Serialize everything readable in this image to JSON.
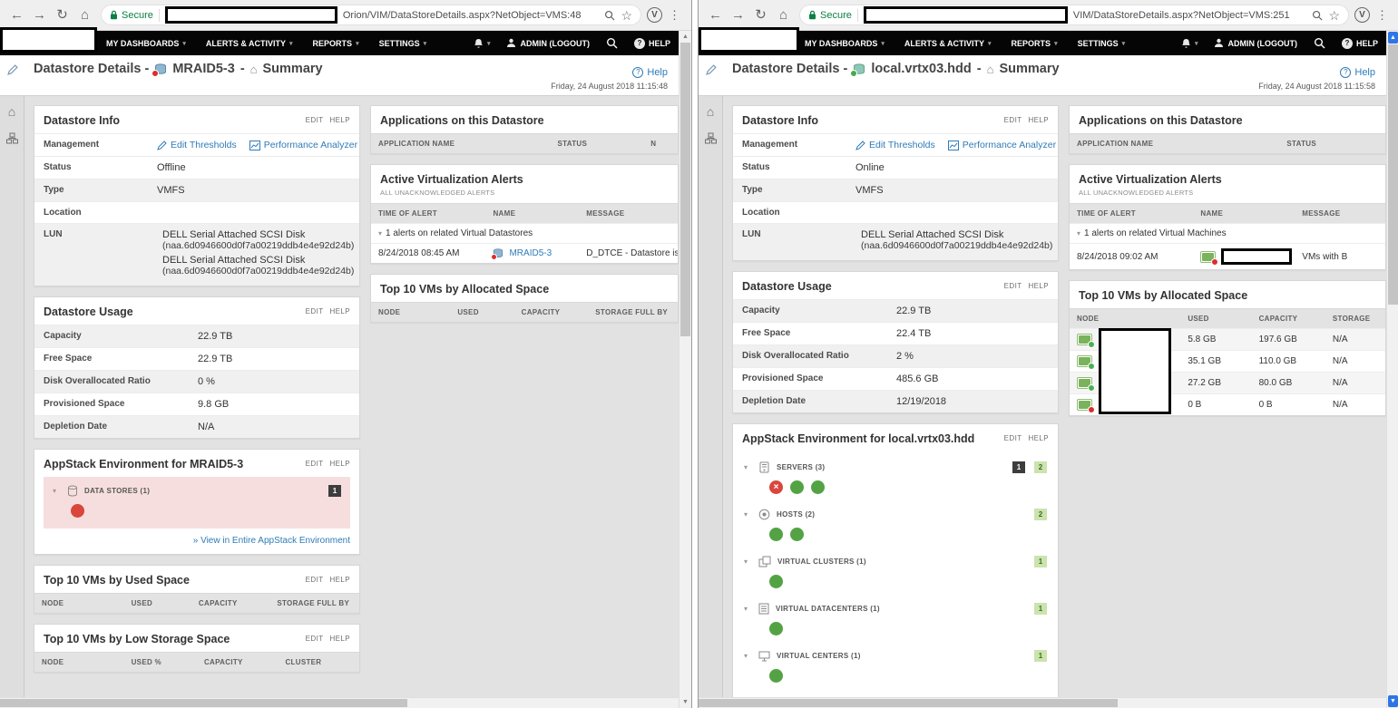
{
  "windows": {
    "left": {
      "browser": {
        "secure": "Secure",
        "url": "Orion/VIM/DataStoreDetails.aspx?NetObject=VMS:48"
      },
      "nav": {
        "dashboards": "MY DASHBOARDS",
        "alerts": "ALERTS & ACTIVITY",
        "reports": "REPORTS",
        "settings": "SETTINGS",
        "admin": "ADMIN (LOGOUT)",
        "help": "HELP"
      },
      "page": {
        "title_prefix": "Datastore Details -",
        "datastore_name": "MRAID5-3",
        "separator": "-",
        "view": "Summary",
        "help": "Help",
        "timestamp": "Friday, 24 August 2018 11:15:48",
        "datastore_status": "down"
      },
      "info": {
        "title": "Datastore Info",
        "edit": "EDIT",
        "help": "HELP",
        "management": "Management",
        "edit_thresholds": "Edit Thresholds",
        "performance_analyzer": "Performance Analyzer",
        "status_label": "Status",
        "status": "Offline",
        "type_label": "Type",
        "type": "VMFS",
        "location_label": "Location",
        "location": "",
        "lun_label": "LUN",
        "luns": [
          {
            "name": "DELL Serial Attached SCSI Disk",
            "naa": "(naa.6d0946600d0f7a00219ddb4e4e92d24b)"
          },
          {
            "name": "DELL Serial Attached SCSI Disk",
            "naa": "(naa.6d0946600d0f7a00219ddb4e4e92d24b)"
          }
        ]
      },
      "usage": {
        "title": "Datastore Usage",
        "edit": "EDIT",
        "help": "HELP",
        "rows": [
          {
            "label": "Capacity",
            "value": "22.9 TB"
          },
          {
            "label": "Free Space",
            "value": "22.9 TB"
          },
          {
            "label": "Disk Overallocated Ratio",
            "value": "0 %"
          },
          {
            "label": "Provisioned Space",
            "value": "9.8 GB"
          },
          {
            "label": "Depletion Date",
            "value": "N/A"
          }
        ]
      },
      "appstack": {
        "title": "AppStack Environment for MRAID5-3",
        "edit": "EDIT",
        "help": "HELP",
        "group_label": "DATA STORES (1)",
        "group_badge": "1",
        "statuses": [
          "down"
        ],
        "view_link": "» View in Entire AppStack Environment"
      },
      "top_used": {
        "title": "Top 10 VMs by Used Space",
        "edit": "EDIT",
        "help": "HELP",
        "headers": [
          "NODE",
          "USED",
          "CAPACITY",
          "STORAGE FULL BY"
        ]
      },
      "top_low": {
        "title": "Top 10 VMs by Low Storage Space",
        "edit": "EDIT",
        "help": "HELP",
        "headers": [
          "NODE",
          "USED %",
          "CAPACITY",
          "CLUSTER"
        ]
      },
      "apps": {
        "title": "Applications on this Datastore",
        "headers": [
          "APPLICATION NAME",
          "STATUS",
          "N"
        ]
      },
      "alerts": {
        "title": "Active Virtualization Alerts",
        "subtitle": "ALL UNACKNOWLEDGED ALERTS",
        "headers": [
          "TIME OF ALERT",
          "NAME",
          "MESSAGE"
        ],
        "group_label": "1 alerts on related Virtual Datastores",
        "row": {
          "time": "8/24/2018 08:45 AM",
          "name": "MRAID5-3",
          "message": "D_DTCE - Datastore is I"
        }
      },
      "top_allocated": {
        "title": "Top 10 VMs by Allocated Space",
        "headers": [
          "NODE",
          "USED",
          "CAPACITY",
          "STORAGE FULL BY"
        ]
      }
    },
    "right": {
      "browser": {
        "secure": "Secure",
        "url": "VIM/DataStoreDetails.aspx?NetObject=VMS:251"
      },
      "nav": {
        "dashboards": "MY DASHBOARDS",
        "alerts": "ALERTS & ACTIVITY",
        "reports": "REPORTS",
        "settings": "SETTINGS",
        "admin": "ADMIN (LOGOUT)",
        "help": "HELP"
      },
      "page": {
        "title_prefix": "Datastore Details -",
        "datastore_name": "local.vrtx03.hdd",
        "separator": "-",
        "view": "Summary",
        "help": "Help",
        "timestamp": "Friday, 24 August 2018 11:15:58",
        "datastore_status": "up"
      },
      "info": {
        "title": "Datastore Info",
        "edit": "EDIT",
        "help": "HELP",
        "management": "Management",
        "edit_thresholds": "Edit Thresholds",
        "performance_analyzer": "Performance Analyzer",
        "status_label": "Status",
        "status": "Online",
        "type_label": "Type",
        "type": "VMFS",
        "location_label": "Location",
        "location": "",
        "lun_label": "LUN",
        "luns": [
          {
            "name": "DELL Serial Attached SCSI Disk",
            "naa": "(naa.6d0946600d0f7a00219ddb4e4e92d24b)"
          }
        ]
      },
      "usage": {
        "title": "Datastore Usage",
        "edit": "EDIT",
        "help": "HELP",
        "rows": [
          {
            "label": "Capacity",
            "value": "22.9 TB"
          },
          {
            "label": "Free Space",
            "value": "22.4 TB"
          },
          {
            "label": "Disk Overallocated Ratio",
            "value": "2 %"
          },
          {
            "label": "Provisioned Space",
            "value": "485.6 GB"
          },
          {
            "label": "Depletion Date",
            "value": "12/19/2018"
          }
        ]
      },
      "appstack": {
        "title": "AppStack Environment for local.vrtx03.hdd",
        "edit": "EDIT",
        "help": "HELP",
        "groups": [
          {
            "label": "SERVERS (3)",
            "badge_down": "1",
            "badge_up": "2",
            "statuses": [
              "down",
              "up",
              "up"
            ]
          },
          {
            "label": "HOSTS (2)",
            "badge_up": "2",
            "statuses": [
              "up",
              "up"
            ]
          },
          {
            "label": "VIRTUAL CLUSTERS (1)",
            "badge_up": "1",
            "statuses": [
              "up"
            ]
          },
          {
            "label": "VIRTUAL DATACENTERS (1)",
            "badge_up": "1",
            "statuses": [
              "up"
            ]
          },
          {
            "label": "VIRTUAL CENTERS (1)",
            "badge_up": "1",
            "statuses": [
              "up"
            ]
          }
        ]
      },
      "apps": {
        "title": "Applications on this Datastore",
        "headers": [
          "APPLICATION NAME",
          "STATUS"
        ]
      },
      "alerts": {
        "title": "Active Virtualization Alerts",
        "subtitle": "ALL UNACKNOWLEDGED ALERTS",
        "headers": [
          "TIME OF ALERT",
          "NAME",
          "MESSAGE"
        ],
        "group_label": "1 alerts on related Virtual Machines",
        "row": {
          "time": "8/24/2018 09:02 AM",
          "name": "",
          "message": "VMs with B"
        }
      },
      "top_allocated": {
        "title": "Top 10 VMs by Allocated Space",
        "headers": [
          "NODE",
          "USED",
          "CAPACITY",
          "STORAGE"
        ],
        "rows": [
          {
            "used": "5.8 GB",
            "capacity": "197.6 GB",
            "storage": "N/A",
            "status": "up"
          },
          {
            "used": "35.1 GB",
            "capacity": "110.0 GB",
            "storage": "N/A",
            "status": "up"
          },
          {
            "used": "27.2 GB",
            "capacity": "80.0 GB",
            "storage": "N/A",
            "status": "up"
          },
          {
            "used": "0 B",
            "capacity": "0 B",
            "storage": "N/A",
            "status": "down"
          }
        ]
      }
    }
  }
}
